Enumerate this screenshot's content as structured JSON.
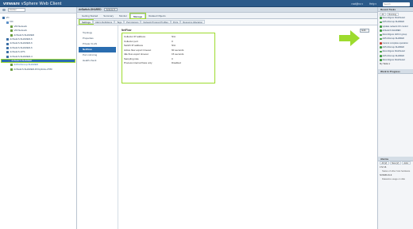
{
  "topbar": {
    "brand_vm": "vmware",
    "brand_rest": " vSphere Web Client",
    "user": "root@vc ▾",
    "help": "Help ▾",
    "search_placeholder": "Search"
  },
  "left": {
    "home_label": "vCenter",
    "tree": [
      {
        "label": "VC",
        "level": 0,
        "color": "#3a6ea5"
      },
      {
        "label": "DC",
        "level": 1,
        "color": "#5b8fc7"
      },
      {
        "label": "VM-Network",
        "level": 2,
        "color": "#6a9e3f"
      },
      {
        "label": "VM-Network",
        "level": 2,
        "color": "#6a9e3f"
      },
      {
        "label": "dvSwitch-SHARED",
        "level": 2,
        "color": "#6a9e3f"
      },
      {
        "label": "dvSwitch-SHARED-6",
        "level": 1,
        "color": "#3a6ea5"
      },
      {
        "label": "dvSwitch-SHARED-6",
        "level": 1,
        "color": "#3a6ea5"
      },
      {
        "label": "dvSwitch-SHARED-6",
        "level": 1,
        "color": "#3a6ea5"
      },
      {
        "label": "dvSwitch-VPS",
        "level": 1,
        "color": "#3a6ea5"
      },
      {
        "label": "dvSwitch-SHARED-4",
        "level": 1,
        "color": "#3a6ea5"
      },
      {
        "label": "dvSwitch-SHARED",
        "level": 1,
        "color": "#3a6ea5",
        "selected": true
      },
      {
        "label": "dvPortGroup-SHARED",
        "level": 2,
        "color": "#6a9e3f",
        "highlight": true
      },
      {
        "label": "dvSwitch-SHARED-DVUplinks-2780",
        "level": 2,
        "color": "#6a9e3f"
      }
    ]
  },
  "center": {
    "title": "dvSwitch-SHARED",
    "actions": "Actions ▾",
    "tabs": [
      "Getting Started",
      "Summary",
      "Monitor",
      "Manage",
      "Related Objects"
    ],
    "active_tab": 3,
    "subtabs": [
      "Settings",
      "Alarm Definitions",
      "Tags",
      "Permissions",
      "Network Protocol Profiles",
      "Ports",
      "Resource Allocation"
    ],
    "active_subtab": 0,
    "sidenav": [
      "Topology",
      "Properties",
      "Private VLAN",
      "NetFlow",
      "Port mirroring",
      "Health check"
    ],
    "active_sidenav": 3,
    "panel_title": "NetFlow",
    "edit_label": "Edit...",
    "rows": [
      {
        "k": "Collector IP address",
        "v": "N/A"
      },
      {
        "k": "Collector port",
        "v": "0"
      },
      {
        "k": "Switch IP address",
        "v": "N/A"
      },
      {
        "k": "Active flow export timeout",
        "v": "60 seconds"
      },
      {
        "k": "Idle flow export timeout",
        "v": "15 seconds"
      },
      {
        "k": "Sampling rate",
        "v": "0"
      },
      {
        "k": "Process internal flows only",
        "v": "Disabled"
      }
    ]
  },
  "right": {
    "tasks_title": "Recent Tasks",
    "tasks_tabs": [
      "All",
      "Running"
    ],
    "tasks": [
      {
        "label": "Reconfigure Distributed",
        "color": "#3a9a3a"
      },
      {
        "label": "dvPortGroup-SHARED",
        "color": "#3a9a3a"
      },
      {
        "label": "Update network I/O control",
        "color": "#3a9a3a"
      },
      {
        "label": "dvSwitch-SHARED",
        "color": "#3a9a3a"
      },
      {
        "label": "Reconfigure dvPort group",
        "color": "#3a9a3a"
      },
      {
        "label": "dvPortGroup-SHARED",
        "color": "#3a9a3a"
      },
      {
        "label": "Cannot complete operation",
        "color": "#c0392b"
      },
      {
        "label": "dvPortGroup-SHARED",
        "color": "#3a9a3a"
      },
      {
        "label": "Reconfigure Distributed",
        "color": "#3a9a3a"
      },
      {
        "label": "dvPortGroup-SHARED",
        "color": "#3a9a3a"
      },
      {
        "label": "Reconfigure Distributed",
        "color": "#3a9a3a"
      }
    ],
    "more_tasks": "My Tasks ▾",
    "work_title": "Work In Progress",
    "alarms_title": "Alarms",
    "alarms_tabs": [
      "All (2)",
      "New (2)",
      "Ackn"
    ],
    "alarms": [
      {
        "label": "172.16.",
        "sub": "Status of other host hardware"
      },
      {
        "label": "NVD1B-01-9",
        "sub": "Datastore usage on disk"
      }
    ]
  }
}
